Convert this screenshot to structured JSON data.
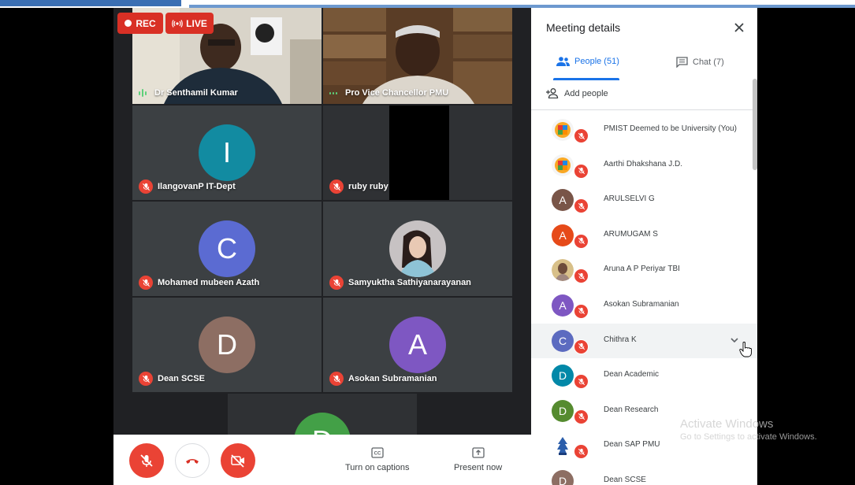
{
  "recording": {
    "rec_label": "REC",
    "live_label": "LIVE"
  },
  "tiles": [
    {
      "name": "Dr Senthamil Kumar",
      "type": "camera",
      "speaking": true
    },
    {
      "name": "Pro Vice Chancellor PMU",
      "type": "camera",
      "speaking": true
    },
    {
      "name": "IlangovanP IT-Dept",
      "type": "avatar",
      "initial": "I",
      "color": "#128ba1"
    },
    {
      "name": "ruby ruby",
      "type": "blank"
    },
    {
      "name": "Mohamed mubeen Azath",
      "type": "avatar",
      "initial": "C",
      "color": "#5b6bd2"
    },
    {
      "name": "Samyuktha Sathiyanarayanan",
      "type": "photo"
    },
    {
      "name": "Dean SCSE",
      "type": "avatar",
      "initial": "D",
      "color": "#8d6e63"
    },
    {
      "name": "Asokan Subramanian",
      "type": "avatar",
      "initial": "A",
      "color": "#7e57c2"
    },
    {
      "name": "",
      "type": "avatar",
      "initial": "D",
      "color": "#43a047"
    }
  ],
  "controls": {
    "captions_label": "Turn on captions",
    "present_label": "Present now"
  },
  "panel": {
    "title": "Meeting details",
    "tab_people": "People (51)",
    "tab_chat": "Chat (7)",
    "add_people": "Add people",
    "participants": [
      {
        "name": "PMIST Deemed to be University (You)",
        "avatar": "logo"
      },
      {
        "name": "Aarthi Dhakshana J.D.",
        "avatar": "logo"
      },
      {
        "name": "ARULSELVI G",
        "initial": "A",
        "color": "#795548"
      },
      {
        "name": "ARUMUGAM S",
        "initial": "A",
        "color": "#e64a19"
      },
      {
        "name": "Aruna A P Periyar TBI",
        "avatar": "photo"
      },
      {
        "name": "Asokan Subramanian",
        "initial": "A",
        "color": "#7e57c2"
      },
      {
        "name": "Chithra K",
        "initial": "C",
        "color": "#5c6bc0"
      },
      {
        "name": "Dean Academic",
        "initial": "D",
        "color": "#0288a8"
      },
      {
        "name": "Dean Research",
        "initial": "D",
        "color": "#558b2f"
      },
      {
        "name": "Dean SAP PMU",
        "avatar": "logo2"
      },
      {
        "name": "Dean SCSE",
        "initial": "D",
        "color": "#8d6e63"
      }
    ]
  },
  "watermark": {
    "line1": "Activate Windows",
    "line2": "Go to Settings to activate Windows."
  }
}
